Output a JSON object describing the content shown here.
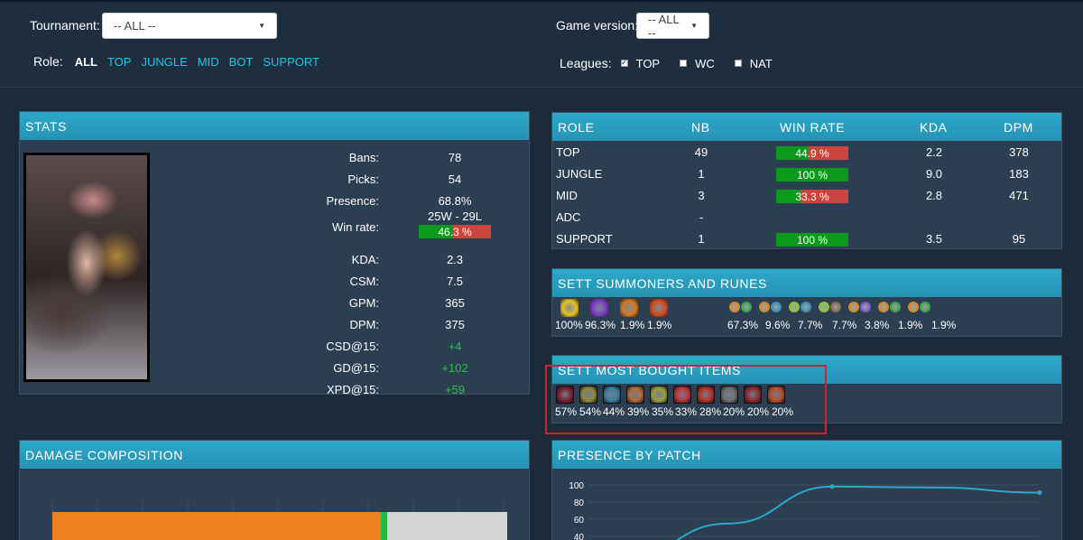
{
  "filters": {
    "tournament_label": "Tournament:",
    "tournament_value": "-- ALL --",
    "game_version_label": "Game version:",
    "game_version_value": "-- ALL --",
    "role_label": "Role:",
    "roles": [
      "ALL",
      "TOP",
      "JUNGLE",
      "MID",
      "BOT",
      "SUPPORT"
    ],
    "leagues_label": "Leagues:",
    "leagues": [
      {
        "label": "TOP",
        "checked": true
      },
      {
        "label": "WC",
        "checked": false
      },
      {
        "label": "NAT",
        "checked": false
      }
    ]
  },
  "stats": {
    "title": "STATS",
    "rows": [
      {
        "key": "Bans:",
        "value": "78"
      },
      {
        "key": "Picks:",
        "value": "54"
      },
      {
        "key": "Presence:",
        "value": "68.8%"
      },
      {
        "key": "Win rate:",
        "value": "25W - 29L"
      },
      {
        "key": "KDA:",
        "value": "2.3"
      },
      {
        "key": "CSM:",
        "value": "7.5"
      },
      {
        "key": "GPM:",
        "value": "365"
      },
      {
        "key": "DPM:",
        "value": "375"
      },
      {
        "key": "CSD@15:",
        "value": "+4"
      },
      {
        "key": "GD@15:",
        "value": "+102"
      },
      {
        "key": "XPD@15:",
        "value": "+59"
      }
    ],
    "win_rate_bar": {
      "label": "46.3 %",
      "fraction": 0.463
    }
  },
  "role_table": {
    "headers": [
      "ROLE",
      "NB",
      "WIN RATE",
      "KDA",
      "DPM"
    ],
    "rows": [
      {
        "role": "TOP",
        "nb": "49",
        "win_rate": "44.9 %",
        "win_fraction": 0.449,
        "kda": "2.2",
        "dpm": "378"
      },
      {
        "role": "JUNGLE",
        "nb": "1",
        "win_rate": "100 %",
        "win_fraction": 1.0,
        "kda": "9.0",
        "dpm": "183"
      },
      {
        "role": "MID",
        "nb": "3",
        "win_rate": "33.3 %",
        "win_fraction": 0.333,
        "kda": "2.8",
        "dpm": "471"
      },
      {
        "role": "ADC",
        "nb": "-",
        "win_rate": "",
        "win_fraction": null,
        "kda": "",
        "dpm": ""
      },
      {
        "role": "SUPPORT",
        "nb": "1",
        "win_rate": "100 %",
        "win_fraction": 1.0,
        "kda": "3.5",
        "dpm": "95"
      }
    ]
  },
  "summoners": {
    "title": "SETT SUMMONERS AND RUNES",
    "summoner_pcts": [
      "100%",
      "96.3%",
      "1.9%",
      "1.9%"
    ],
    "rune_pcts": [
      "67.3%",
      "9.6%",
      "7.7%",
      "7.7%",
      "3.8%",
      "1.9%",
      "1.9%"
    ],
    "summoner_icons": [
      "flash-icon",
      "teleport-icon",
      "ignite-icon",
      "ignite-alt-icon"
    ],
    "summoner_colors": [
      "#e8c21f",
      "#7b3cc4",
      "#d8751e",
      "#d44a1e"
    ]
  },
  "items": {
    "title": "SETT MOST BOUGHT ITEMS",
    "pcts": [
      "57%",
      "54%",
      "44%",
      "39%",
      "35%",
      "33%",
      "28%",
      "20%",
      "20%",
      "20%"
    ],
    "colors": [
      "#7a2230",
      "#8c8a3a",
      "#3b7fa0",
      "#b06b3a",
      "#9aa23a",
      "#c0323a",
      "#b83028",
      "#6e6e6e",
      "#8b2a30",
      "#b5502a"
    ]
  },
  "damage": {
    "title": "DAMAGE COMPOSITION"
  },
  "presence": {
    "title": "PRESENCE BY PATCH",
    "y_ticks": [
      "100",
      "80",
      "60",
      "40"
    ]
  },
  "chart_data": {
    "type": "line",
    "title": "PRESENCE BY PATCH",
    "xlabel": "",
    "ylabel": "",
    "ylim": [
      0,
      100
    ],
    "x": [
      0,
      1,
      2,
      3,
      4
    ],
    "series": [
      {
        "values": [
          15,
          55,
          98,
          97,
          91
        ]
      }
    ],
    "y_ticks": [
      100,
      80,
      60,
      40
    ],
    "grid": true
  }
}
